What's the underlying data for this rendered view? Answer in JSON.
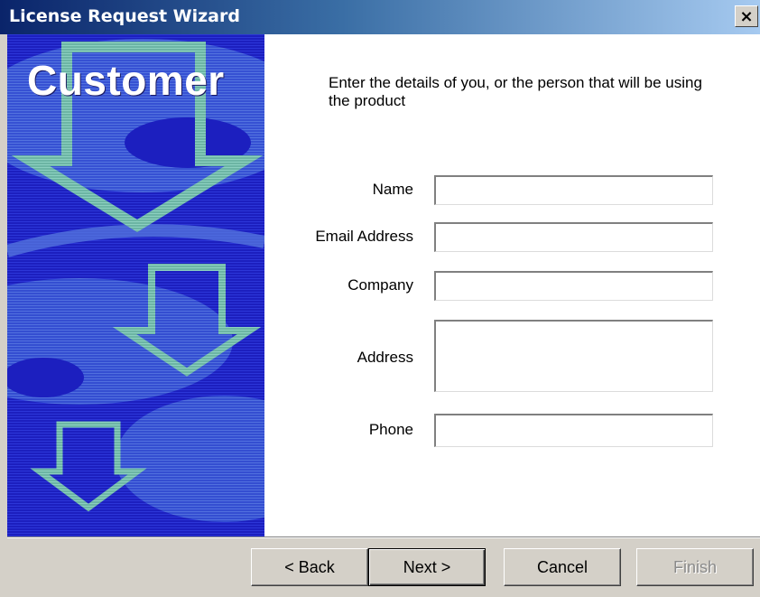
{
  "window": {
    "title": "License Request Wizard",
    "close_label": "×"
  },
  "banner": {
    "title": "Customer",
    "colors": {
      "background": "#1e22c8",
      "arrows": "#6fb8a8",
      "swirl": "#3a52c8"
    }
  },
  "form": {
    "instruction": "Enter the details of you, or the person that will be using the product",
    "fields": [
      {
        "label": "Name",
        "value": ""
      },
      {
        "label": "Email Address",
        "value": ""
      },
      {
        "label": "Company",
        "value": ""
      },
      {
        "label": "Address",
        "value": ""
      },
      {
        "label": "Phone",
        "value": ""
      }
    ]
  },
  "buttons": {
    "back": "< Back",
    "next": "Next >",
    "cancel": "Cancel",
    "finish": "Finish"
  }
}
